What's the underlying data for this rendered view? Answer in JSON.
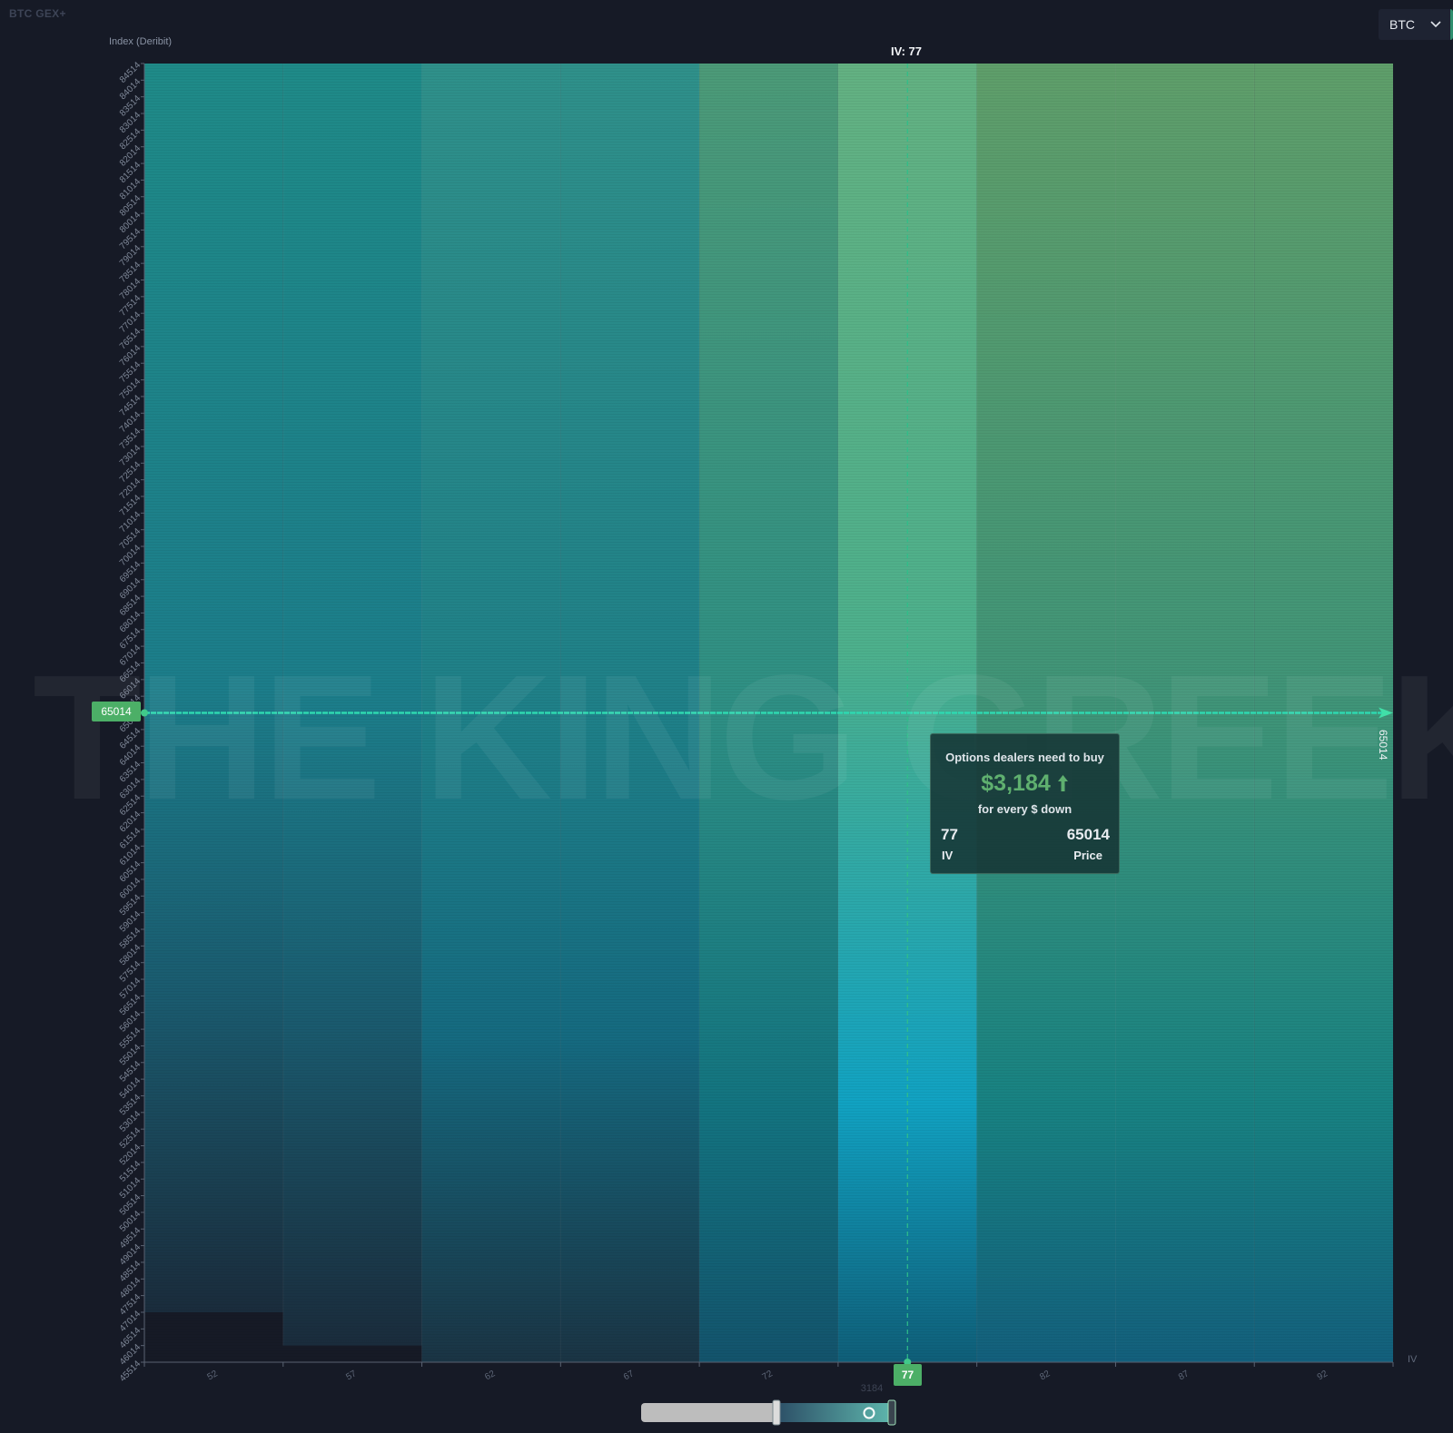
{
  "app": {
    "title": "BTC GEX+"
  },
  "asset_select": {
    "value": "BTC",
    "icon": "chevron-down-icon"
  },
  "watermark": "THE  KING GREEKS.IO",
  "crosshair": {
    "iv_top_label": "IV: 77",
    "price_left_label": "65014",
    "price_right_label": "65014",
    "iv_bottom_label": "77"
  },
  "tooltip": {
    "heading": "Options dealers need to buy",
    "amount": "$3,184",
    "arrow_icon": "arrow-up-icon",
    "subheading": "for every $ down",
    "iv_value": "77",
    "iv_label": "IV",
    "price_value": "65014",
    "price_label": "Price"
  },
  "slider": {
    "value_label": "3184"
  },
  "colors": {
    "accent_green": "#4caf67",
    "background": "#161a26",
    "highlight_column": "#5cb387"
  },
  "chart_data": {
    "type": "heatmap",
    "title": "",
    "xlabel": "IV",
    "ylabel": "Index (Deribit)",
    "x_ticks": [
      "52",
      "57",
      "62",
      "67",
      "72",
      "77",
      "82",
      "87",
      "92"
    ],
    "x_columns": [
      52,
      57,
      62,
      67,
      72,
      77,
      82,
      87,
      92
    ],
    "y_ticks": [
      "84514",
      "84014",
      "83514",
      "83014",
      "82514",
      "82014",
      "81514",
      "81014",
      "80514",
      "80014",
      "79514",
      "79014",
      "78514",
      "78014",
      "77514",
      "77014",
      "76514",
      "76014",
      "75514",
      "75014",
      "74514",
      "74014",
      "73514",
      "73014",
      "72514",
      "72014",
      "71514",
      "71014",
      "70514",
      "70014",
      "69514",
      "69014",
      "68514",
      "68014",
      "67514",
      "67014",
      "66514",
      "66014",
      "65514",
      "65014",
      "64514",
      "64014",
      "63514",
      "63014",
      "62514",
      "62014",
      "61514",
      "61014",
      "60514",
      "60014",
      "59514",
      "59014",
      "58514",
      "58014",
      "57514",
      "57014",
      "56514",
      "56014",
      "55514",
      "55014",
      "54514",
      "54014",
      "53514",
      "53014",
      "52514",
      "52014",
      "51514",
      "51014",
      "50514",
      "50014",
      "49514",
      "49014",
      "48514",
      "48014",
      "47514",
      "47014",
      "46514",
      "46014",
      "45514"
    ],
    "ylim": [
      45514,
      84514
    ],
    "column_data_floor": [
      47014,
      46014,
      45514,
      45514,
      45514,
      45514,
      45514,
      45514,
      45514
    ],
    "selected": {
      "iv": 77,
      "price": 65014,
      "gex_per_dollar": 3184
    },
    "grid": false,
    "legend": "none"
  }
}
